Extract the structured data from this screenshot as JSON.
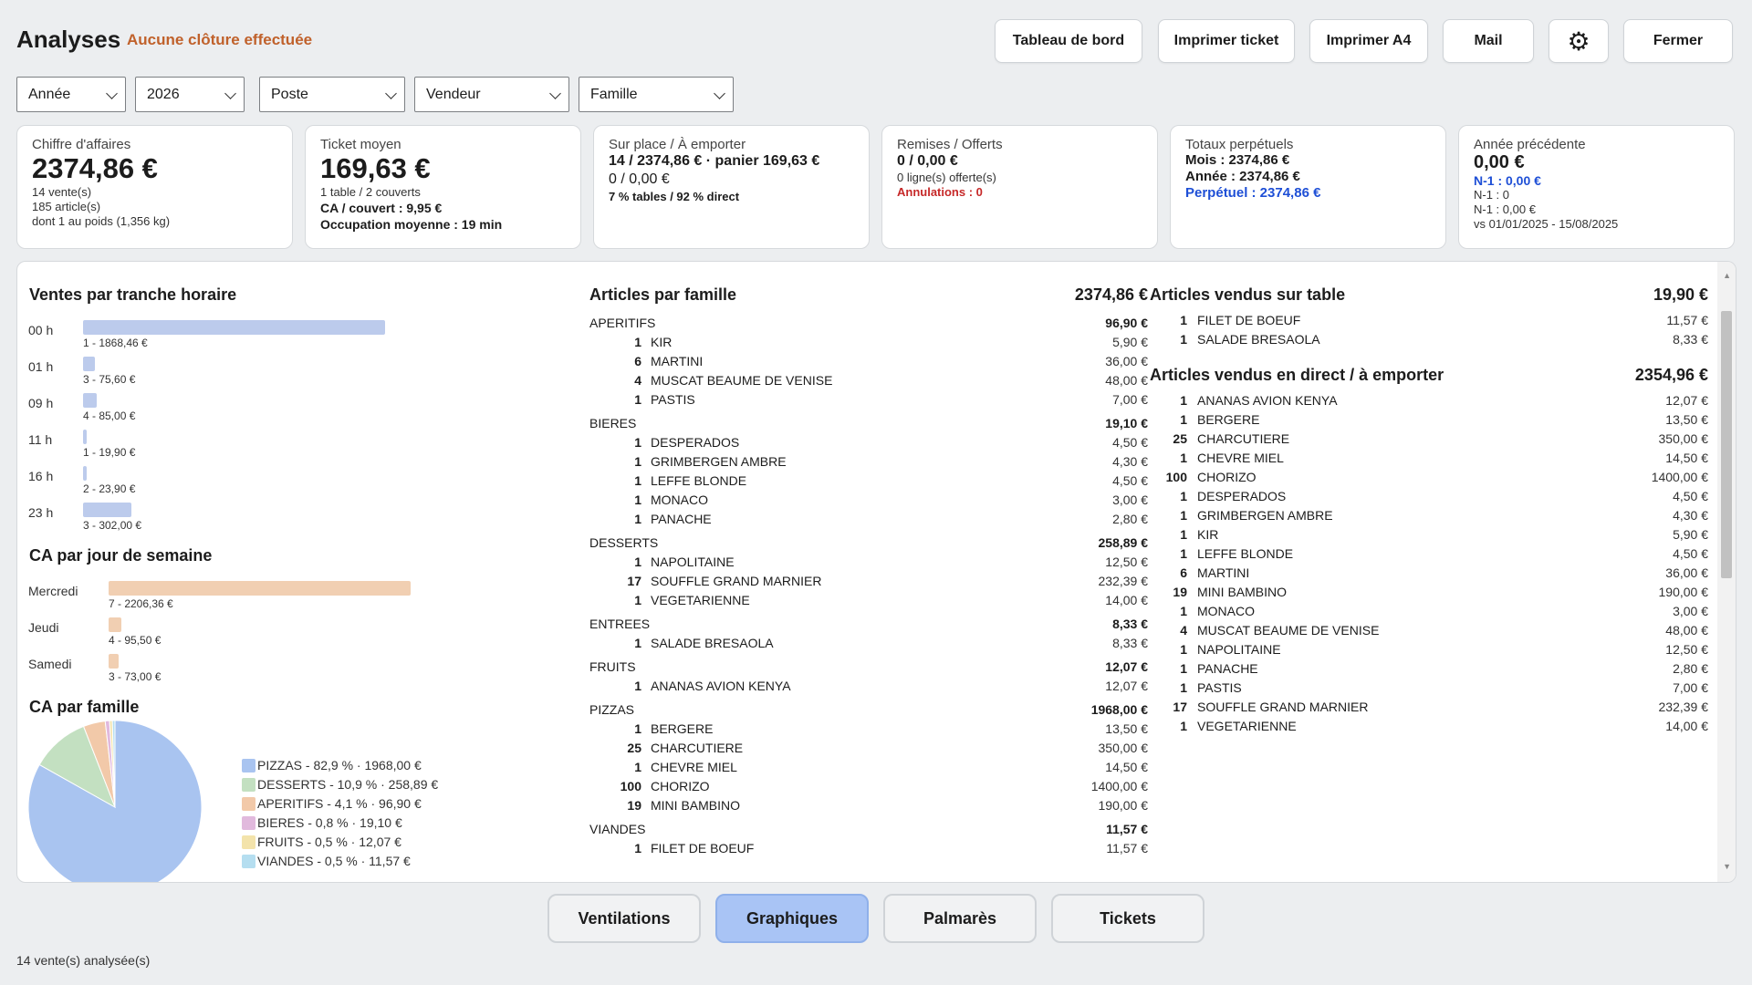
{
  "header": {
    "title": "Analyses",
    "status": "Aucune clôture effectuée",
    "buttons": [
      "Tableau de bord",
      "Imprimer ticket",
      "Imprimer A4",
      "Mail",
      "Fermer"
    ],
    "settings_icon": "gear-icon"
  },
  "filters": {
    "period": "Année",
    "year": "2026",
    "station": "Poste",
    "seller": "Vendeur",
    "family": "Famille"
  },
  "cards": {
    "revenue": {
      "label": "Chiffre d'affaires",
      "value": "2374,86 €",
      "l1": "14 vente(s)",
      "l2": "185 article(s)",
      "l3": "dont 1 au poids (1,356 kg)"
    },
    "avg_ticket": {
      "label": "Ticket moyen",
      "value": "169,63 €",
      "l1": "1 table / 2 couverts",
      "l2": "CA / couvert : 9,95 €",
      "l3": "Occupation moyenne : 19 min"
    },
    "onsite": {
      "label": "Sur place / À emporter",
      "l1": "14 / 2374,86 € · panier 169,63 €",
      "l2": "0 / 0,00 €",
      "l3": "7 % tables / 92 % direct"
    },
    "discounts": {
      "label": "Remises / Offerts",
      "l1": "0 / 0,00 €",
      "l2": "0 ligne(s) offerte(s)",
      "l3": "Annulations : 0"
    },
    "perpetual": {
      "label": "Totaux perpétuels",
      "l1": "Mois : 2374,86 €",
      "l2": "Année : 2374,86 €",
      "l3": "Perpétuel : 2374,86 €"
    },
    "prev_year": {
      "label": "Année précédente",
      "value": "0,00 €",
      "l1": "N-1 : 0,00 €",
      "l2": "N-1 : 0",
      "l3": "N-1 : 0,00 €",
      "l4": "vs 01/01/2025 - 15/08/2025"
    }
  },
  "hourly": {
    "title": "Ventes par tranche horaire",
    "rows": [
      {
        "label": "00 h",
        "caption": "1 - 1868,46 €",
        "amount": 1868.46
      },
      {
        "label": "01 h",
        "caption": "3 - 75,60 €",
        "amount": 75.6
      },
      {
        "label": "09 h",
        "caption": "4 - 85,00 €",
        "amount": 85.0
      },
      {
        "label": "11 h",
        "caption": "1 - 19,90 €",
        "amount": 19.9
      },
      {
        "label": "16 h",
        "caption": "2 - 23,90 €",
        "amount": 23.9
      },
      {
        "label": "23 h",
        "caption": "3 - 302,00 €",
        "amount": 302.0
      }
    ],
    "color": "#bccbec"
  },
  "weekday": {
    "title": "CA par jour de semaine",
    "rows": [
      {
        "label": "Mercredi",
        "caption": "7 - 2206,36 €",
        "amount": 2206.36
      },
      {
        "label": "Jeudi",
        "caption": "4 - 95,50 €",
        "amount": 95.5
      },
      {
        "label": "Samedi",
        "caption": "3 - 73,00 €",
        "amount": 73.0
      }
    ],
    "color": "#f1cfb2"
  },
  "chart_data": {
    "type": "pie",
    "title": "CA par famille",
    "categories": [
      "PIZZAS",
      "DESSERTS",
      "APERITIFS",
      "BIERES",
      "FRUITS",
      "VIANDES"
    ],
    "values": [
      1968.0,
      258.89,
      96.9,
      19.1,
      12.07,
      11.57
    ],
    "labels": [
      "PIZZAS - 82,9 % · 1968,00 €",
      "DESSERTS - 10,9 % · 258,89 €",
      "APERITIFS - 4,1 % · 96,90 €",
      "BIERES - 0,8 % · 19,10 €",
      "FRUITS - 0,5 % · 12,07 €",
      "VIANDES - 0,5 % · 11,57 €"
    ],
    "colors": [
      "#a9c4f0",
      "#c3e0c1",
      "#f2c9a9",
      "#e1b9dd",
      "#f3e3ab",
      "#b5def0"
    ]
  },
  "families": {
    "title": "Articles par famille",
    "total": "2374,86 €",
    "groups": [
      {
        "name": "APERITIFS",
        "total": "96,90 €",
        "items": [
          [
            "1",
            "KIR",
            "5,90 €"
          ],
          [
            "6",
            "MARTINI",
            "36,00 €"
          ],
          [
            "4",
            "MUSCAT BEAUME DE VENISE",
            "48,00 €"
          ],
          [
            "1",
            "PASTIS",
            "7,00 €"
          ]
        ]
      },
      {
        "name": "BIERES",
        "total": "19,10 €",
        "items": [
          [
            "1",
            "DESPERADOS",
            "4,50 €"
          ],
          [
            "1",
            "GRIMBERGEN AMBRE",
            "4,30 €"
          ],
          [
            "1",
            "LEFFE BLONDE",
            "4,50 €"
          ],
          [
            "1",
            "MONACO",
            "3,00 €"
          ],
          [
            "1",
            "PANACHE",
            "2,80 €"
          ]
        ]
      },
      {
        "name": "DESSERTS",
        "total": "258,89 €",
        "items": [
          [
            "1",
            "NAPOLITAINE",
            "12,50 €"
          ],
          [
            "17",
            "SOUFFLE GRAND MARNIER",
            "232,39 €"
          ],
          [
            "1",
            "VEGETARIENNE",
            "14,00 €"
          ]
        ]
      },
      {
        "name": "ENTREES",
        "total": "8,33 €",
        "items": [
          [
            "1",
            "SALADE BRESAOLA",
            "8,33 €"
          ]
        ]
      },
      {
        "name": "FRUITS",
        "total": "12,07 €",
        "items": [
          [
            "1",
            "ANANAS AVION KENYA",
            "12,07 €"
          ]
        ]
      },
      {
        "name": "PIZZAS",
        "total": "1968,00 €",
        "items": [
          [
            "1",
            "BERGERE",
            "13,50 €"
          ],
          [
            "25",
            "CHARCUTIERE",
            "350,00 €"
          ],
          [
            "1",
            "CHEVRE MIEL",
            "14,50 €"
          ],
          [
            "100",
            "CHORIZO",
            "1400,00 €"
          ],
          [
            "19",
            "MINI BAMBINO",
            "190,00 €"
          ]
        ]
      },
      {
        "name": "VIANDES",
        "total": "11,57 €",
        "items": [
          [
            "1",
            "FILET DE BOEUF",
            "11,57 €"
          ]
        ]
      }
    ]
  },
  "table_items": {
    "title": "Articles vendus sur table",
    "total": "19,90 €",
    "items": [
      [
        "1",
        "FILET DE BOEUF",
        "11,57 €"
      ],
      [
        "1",
        "SALADE BRESAOLA",
        "8,33 €"
      ]
    ]
  },
  "direct_items": {
    "title": "Articles vendus en direct / à emporter",
    "total": "2354,96 €",
    "items": [
      [
        "1",
        "ANANAS AVION KENYA",
        "12,07 €"
      ],
      [
        "1",
        "BERGERE",
        "13,50 €"
      ],
      [
        "25",
        "CHARCUTIERE",
        "350,00 €"
      ],
      [
        "1",
        "CHEVRE MIEL",
        "14,50 €"
      ],
      [
        "100",
        "CHORIZO",
        "1400,00 €"
      ],
      [
        "1",
        "DESPERADOS",
        "4,50 €"
      ],
      [
        "1",
        "GRIMBERGEN AMBRE",
        "4,30 €"
      ],
      [
        "1",
        "KIR",
        "5,90 €"
      ],
      [
        "1",
        "LEFFE BLONDE",
        "4,50 €"
      ],
      [
        "6",
        "MARTINI",
        "36,00 €"
      ],
      [
        "19",
        "MINI BAMBINO",
        "190,00 €"
      ],
      [
        "1",
        "MONACO",
        "3,00 €"
      ],
      [
        "4",
        "MUSCAT BEAUME DE VENISE",
        "48,00 €"
      ],
      [
        "1",
        "NAPOLITAINE",
        "12,50 €"
      ],
      [
        "1",
        "PANACHE",
        "2,80 €"
      ],
      [
        "1",
        "PASTIS",
        "7,00 €"
      ],
      [
        "17",
        "SOUFFLE GRAND MARNIER",
        "232,39 €"
      ],
      [
        "1",
        "VEGETARIENNE",
        "14,00 €"
      ]
    ]
  },
  "tabs": {
    "items": [
      "Ventilations",
      "Graphiques",
      "Palmarès",
      "Tickets"
    ],
    "active": "Graphiques"
  },
  "footer": {
    "text": "14 vente(s) analysée(s)"
  }
}
